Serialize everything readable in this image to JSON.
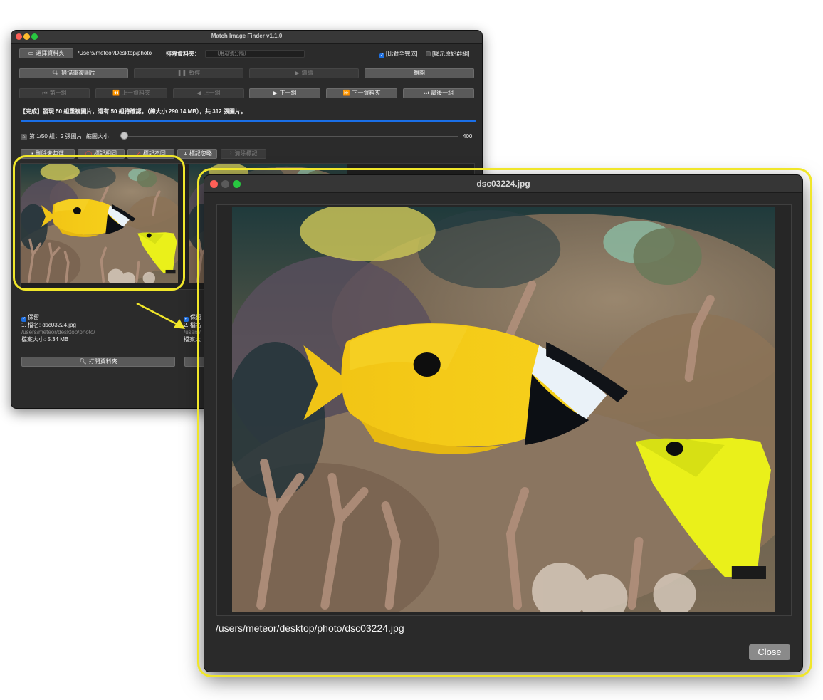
{
  "main_window": {
    "title": "Match Image Finder v1.1.0",
    "toolbar": {
      "select_folder_label": "選擇資料夾",
      "folder_path": "/Users/meteor/Desktop/photo",
      "exclude_label": "排除資料夾：",
      "exclude_placeholder": "（用逗號分隔）",
      "compare_done_label": "[比對至完成]",
      "show_groups_label": "[顯示原始群組]"
    },
    "actions": {
      "scan_label": "掃描重複圖片",
      "pause_label": "暫停",
      "continue_label": "繼續",
      "leave_label": "離開"
    },
    "navigation": {
      "first_label": "第一組",
      "prev_folder_label": "上一資料夾",
      "prev_label": "上一組",
      "next_label": "下一組",
      "next_folder_label": "下一資料夾",
      "last_label": "最後一組"
    },
    "status_text": "【完成】發現 50 組重複圖片，還有 50 組待確認。（總大小 290.14 MB），共 312 張圖片。",
    "progress_fraction": 1.0,
    "group": {
      "group_info": "第 1/50 組：2 張圖片",
      "thumb_size_label": "縮圖大小",
      "thumb_size_value": "400",
      "slider_fraction": 0.0
    },
    "mark_buttons": {
      "delete_unchecked": "刪除未勾選",
      "mark_same": "標記相同",
      "mark_different": "標記不同",
      "mark_ignore": "標記忽略",
      "clear_marks": "清除標記"
    },
    "images": [
      {
        "keep_label": "保留",
        "name_line": "1. 檔名: dsc03224.jpg",
        "folder": "/users/meteor/desktop/photo/",
        "size_line": "檔案大小: 5.34 MB",
        "open_folder_label": "打開資料夾"
      },
      {
        "keep_label": "保留",
        "name_line": "2. 檔名",
        "folder": "/users/",
        "size_line": "檔案大",
        "open_folder_label": ""
      }
    ]
  },
  "viewer": {
    "title": "dsc03224.jpg",
    "path": "/users/meteor/desktop/photo/dsc03224.jpg",
    "close_label": "Close"
  },
  "colors": {
    "accent": "#1a6fe8",
    "highlight": "#f0e62a",
    "window_bg": "#2b2b2b"
  },
  "icons": {
    "folder": "folder-icon",
    "search": "magnifier-icon",
    "pause": "pause-icon",
    "play": "play-icon",
    "home": "home-icon"
  }
}
